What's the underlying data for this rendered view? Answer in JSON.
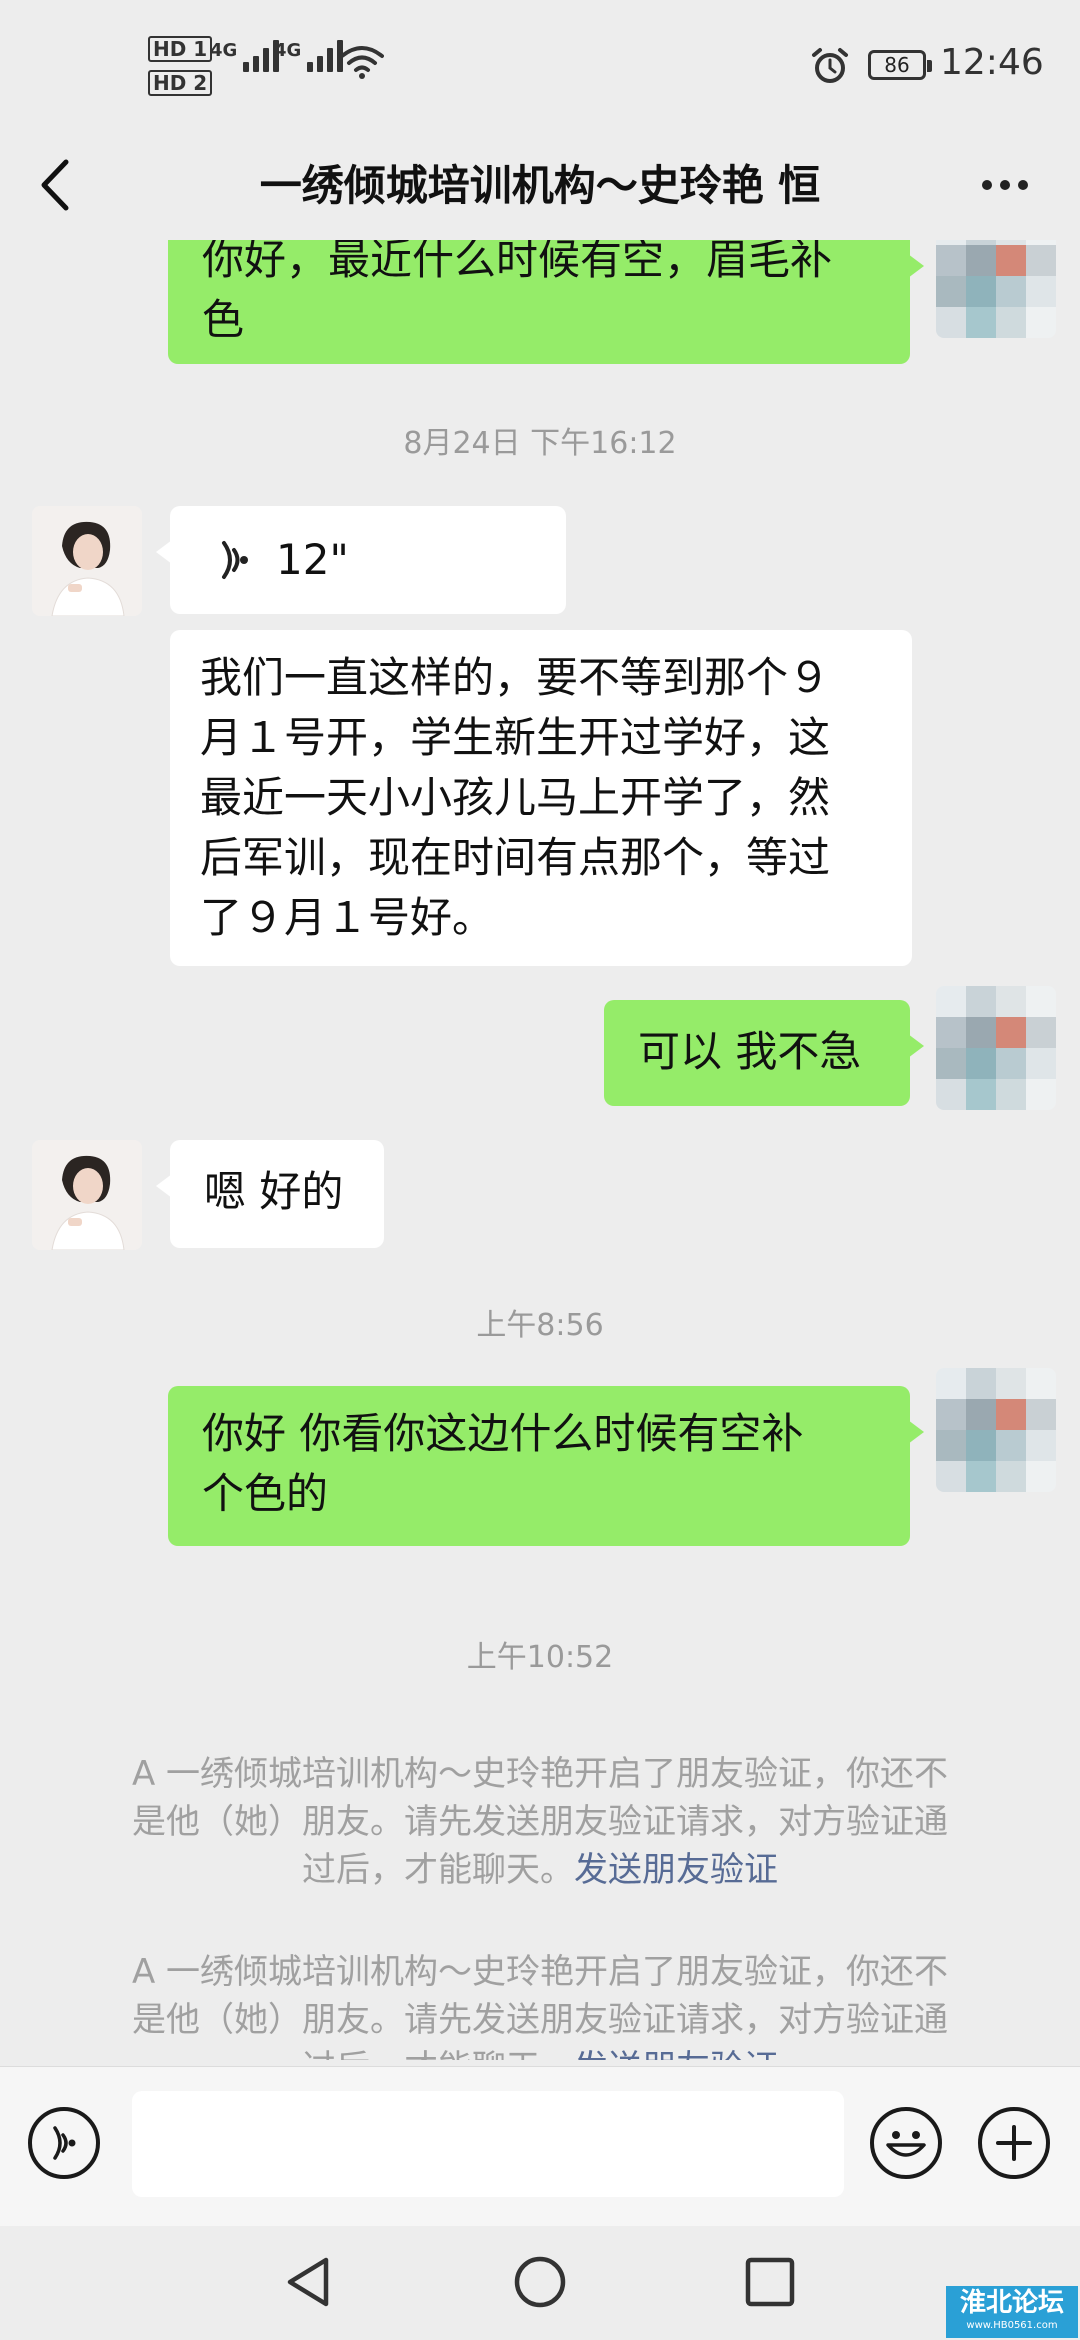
{
  "status_bar": {
    "hd1": "HD 1",
    "hd2": "HD 2",
    "net1": "4G",
    "net2": "4G",
    "battery": "86",
    "time": "12:46"
  },
  "header": {
    "title": "一绣倾城培训机构～史玲艳  恒"
  },
  "messages": {
    "m1": {
      "lines": [
        "你好，最近什么时候有空，眉毛补",
        "色"
      ]
    },
    "t1": "8月24日 下午16:12",
    "m2": {
      "duration": "12\""
    },
    "m3": {
      "lines": [
        "我们一直这样的，要不等到那个９",
        "月１号开，学生新生开过学好，这",
        "最近一天小小孩儿马上开学了，然",
        "后军训，现在时间有点那个，等过",
        "了９月１号好。"
      ]
    },
    "m4": {
      "text": "可以 我不急"
    },
    "m5": {
      "text": "嗯 好的"
    },
    "t2": "上午8:56",
    "m6": {
      "lines": [
        "你好 你看你这边什么时候有空补",
        "个色的"
      ]
    },
    "t3": "上午10:52",
    "sys1": {
      "lines": [
        "A 一绣倾城培训机构～史玲艳开启了朋友验证，你还不",
        "是他（她）朋友。请先发送朋友验证请求，对方验证通",
        "过后，才能聊天。"
      ],
      "link": "发送朋友验证"
    },
    "sys2": {
      "lines": [
        "A 一绣倾城培训机构～史玲艳开启了朋友验证，你还不",
        "是他（她）朋友。请先发送朋友验证请求，对方验证通",
        "过后，才能聊天。"
      ],
      "link": "发送朋友验证"
    }
  },
  "input_bar": {
    "voice_icon": "voice-mode-icon",
    "emoji_icon": "emoji-icon",
    "plus_icon": "plus-icon"
  },
  "nav_bar": {
    "back_icon": "nav-back-icon",
    "home_icon": "nav-home-icon",
    "recent_icon": "nav-recent-icon"
  },
  "watermark": {
    "title": "淮北论坛",
    "url": "www.HB0561.com"
  },
  "colors": {
    "sent_bubble": "#95ec69",
    "received_bubble": "#ffffff",
    "background": "#ededed",
    "link": "#576b95",
    "watermark": "#2aa0d6"
  }
}
